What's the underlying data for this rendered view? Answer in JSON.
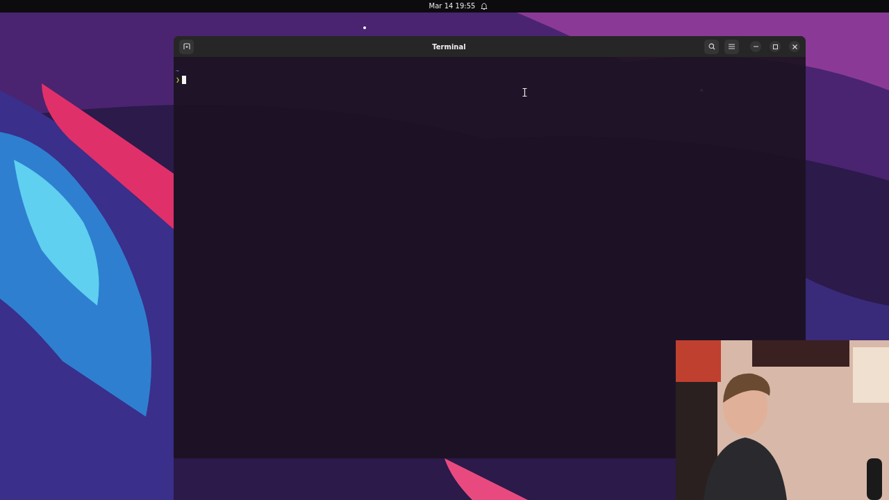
{
  "top_bar": {
    "clock": "Mar 14 19:55"
  },
  "window": {
    "title": "Terminal"
  },
  "terminal": {
    "lines": [
      {
        "kind": "cwd",
        "text": "~"
      },
      {
        "kind": "prompt",
        "text": "❯"
      }
    ],
    "cursor": true
  }
}
